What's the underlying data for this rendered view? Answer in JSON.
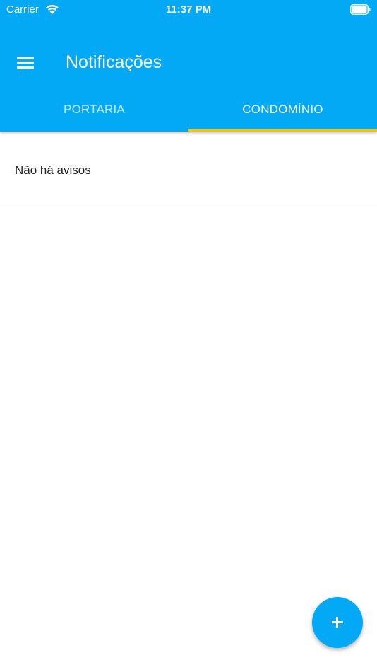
{
  "status_bar": {
    "carrier": "Carrier",
    "time": "11:37 PM",
    "icons": [
      "wifi-icon",
      "battery-icon"
    ]
  },
  "toolbar": {
    "menu_icon": "hamburger-menu-icon",
    "title": "Notificações"
  },
  "tabs": [
    {
      "label": "PORTARIA",
      "selected": false
    },
    {
      "label": "CONDOMÍNIO",
      "selected": true
    }
  ],
  "content": {
    "empty_message": "Não há avisos"
  },
  "fab": {
    "icon": "plus-icon"
  },
  "colors": {
    "primary": "#03a9f4",
    "tab_indicator": "#f4c400",
    "background": "#ffffff"
  }
}
